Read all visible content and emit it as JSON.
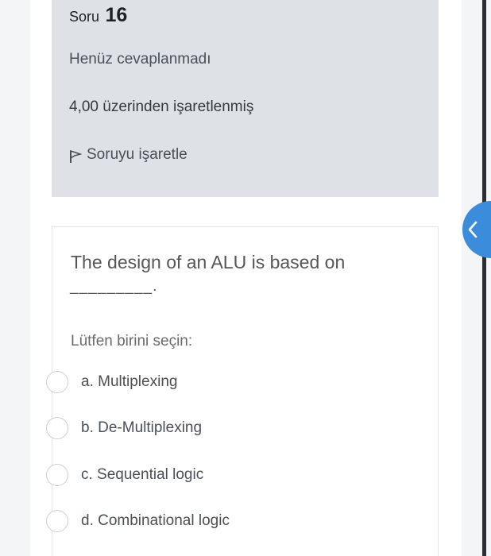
{
  "question_info": {
    "label": "Soru",
    "number": "16",
    "state": "Henüz cevaplanmadı",
    "grade": "4,00 üzerinden işaretlenmiş",
    "flag_label": "Soruyu işaretle",
    "flag_icon": "flag-icon"
  },
  "question": {
    "text": "The design of an ALU is based on",
    "blank": "_________.",
    "prompt": "Lütfen birini seçin:",
    "options": [
      {
        "label": "a. Multiplexing",
        "selected": false
      },
      {
        "label": "b. De-Multiplexing",
        "selected": false
      },
      {
        "label": "c. Sequential logic",
        "selected": false
      },
      {
        "label": "d. Combinational logic",
        "selected": false
      }
    ]
  },
  "drawer_toggle": {
    "icon": "chevron-left-icon",
    "color": "#3b8ddb"
  },
  "colors": {
    "info_bg": "#dee2e6",
    "page_bg": "#ffffff",
    "accent": "#3b8ddb"
  }
}
